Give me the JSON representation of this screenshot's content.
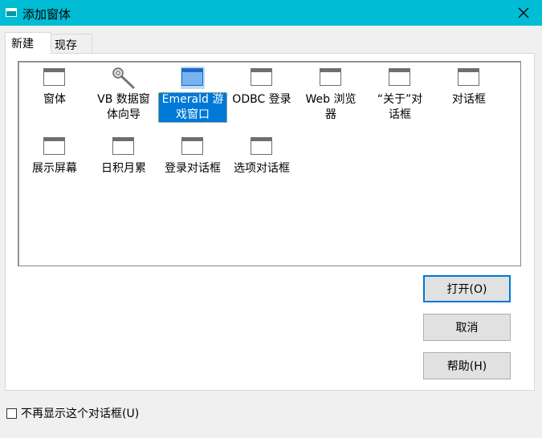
{
  "window": {
    "title": "添加窗体",
    "close_icon": "close-icon"
  },
  "tabs": [
    {
      "label": "新建"
    },
    {
      "label": "现存"
    }
  ],
  "items": [
    {
      "label": "窗体",
      "icon": "form-window-icon"
    },
    {
      "label": "VB 数据窗体向导",
      "icon": "wizard-wand-icon"
    },
    {
      "label": "Emerald 游戏窗口",
      "icon": "form-window-icon",
      "selected": true
    },
    {
      "label": "ODBC 登录",
      "icon": "form-window-icon"
    },
    {
      "label": "Web 浏览器",
      "icon": "form-window-icon"
    },
    {
      "label": "“关于”对话框",
      "icon": "form-window-icon"
    },
    {
      "label": "对话框",
      "icon": "form-window-icon"
    },
    {
      "label": "展示屏幕",
      "icon": "form-window-icon"
    },
    {
      "label": "日积月累",
      "icon": "form-window-icon"
    },
    {
      "label": "登录对话框",
      "icon": "form-window-icon"
    },
    {
      "label": "选项对话框",
      "icon": "form-window-icon"
    }
  ],
  "buttons": {
    "open": "打开(O)",
    "cancel": "取消",
    "help": "帮助(H)"
  },
  "checkbox": {
    "label": "不再显示这个对话框(U)",
    "checked": false
  },
  "colors": {
    "titlebar": "#00bcd4",
    "selection": "#0078d7"
  }
}
